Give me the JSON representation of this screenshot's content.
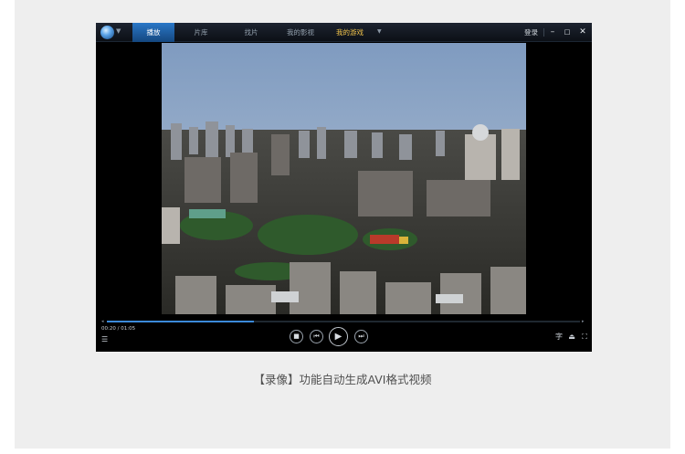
{
  "window": {
    "tabs": [
      {
        "label": "播放",
        "state": "active"
      },
      {
        "label": "片库"
      },
      {
        "label": "找片"
      },
      {
        "label": "我的影视"
      },
      {
        "label": "我的游戏",
        "state": "highlight"
      }
    ],
    "login_label": "登录",
    "minimize_glyph": "–",
    "maximize_glyph": "□",
    "close_glyph": "✕"
  },
  "player": {
    "current_time": "00:20",
    "total_time": "01:05",
    "time_separator": " / ",
    "progress": 0.31,
    "accent_color": "#3b8ad9",
    "controls": {
      "stop_glyph": "■",
      "prev_glyph": "⏮",
      "play_glyph": "▶",
      "next_glyph": "⏭"
    },
    "right_icons": {
      "subtitle_glyph": "字",
      "eject_glyph": "⏏",
      "fullscreen_glyph": "⛶"
    }
  },
  "caption": "【录像】功能自动生成AVI格式视频"
}
